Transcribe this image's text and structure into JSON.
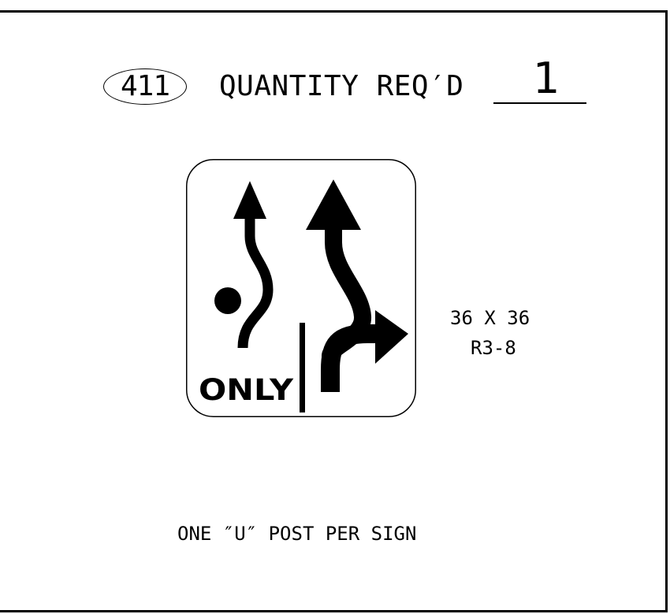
{
  "sheet": {
    "sign_number": "411",
    "quantity_label": "QUANTITY REQ′D",
    "quantity_value": "1"
  },
  "sign": {
    "legend": "ONLY",
    "size": "36 X 36",
    "code": "R3-8",
    "background_color": "#ffffff",
    "symbol_color": "#000000"
  },
  "notes": {
    "post": "ONE ″U″ POST PER SIGN"
  }
}
